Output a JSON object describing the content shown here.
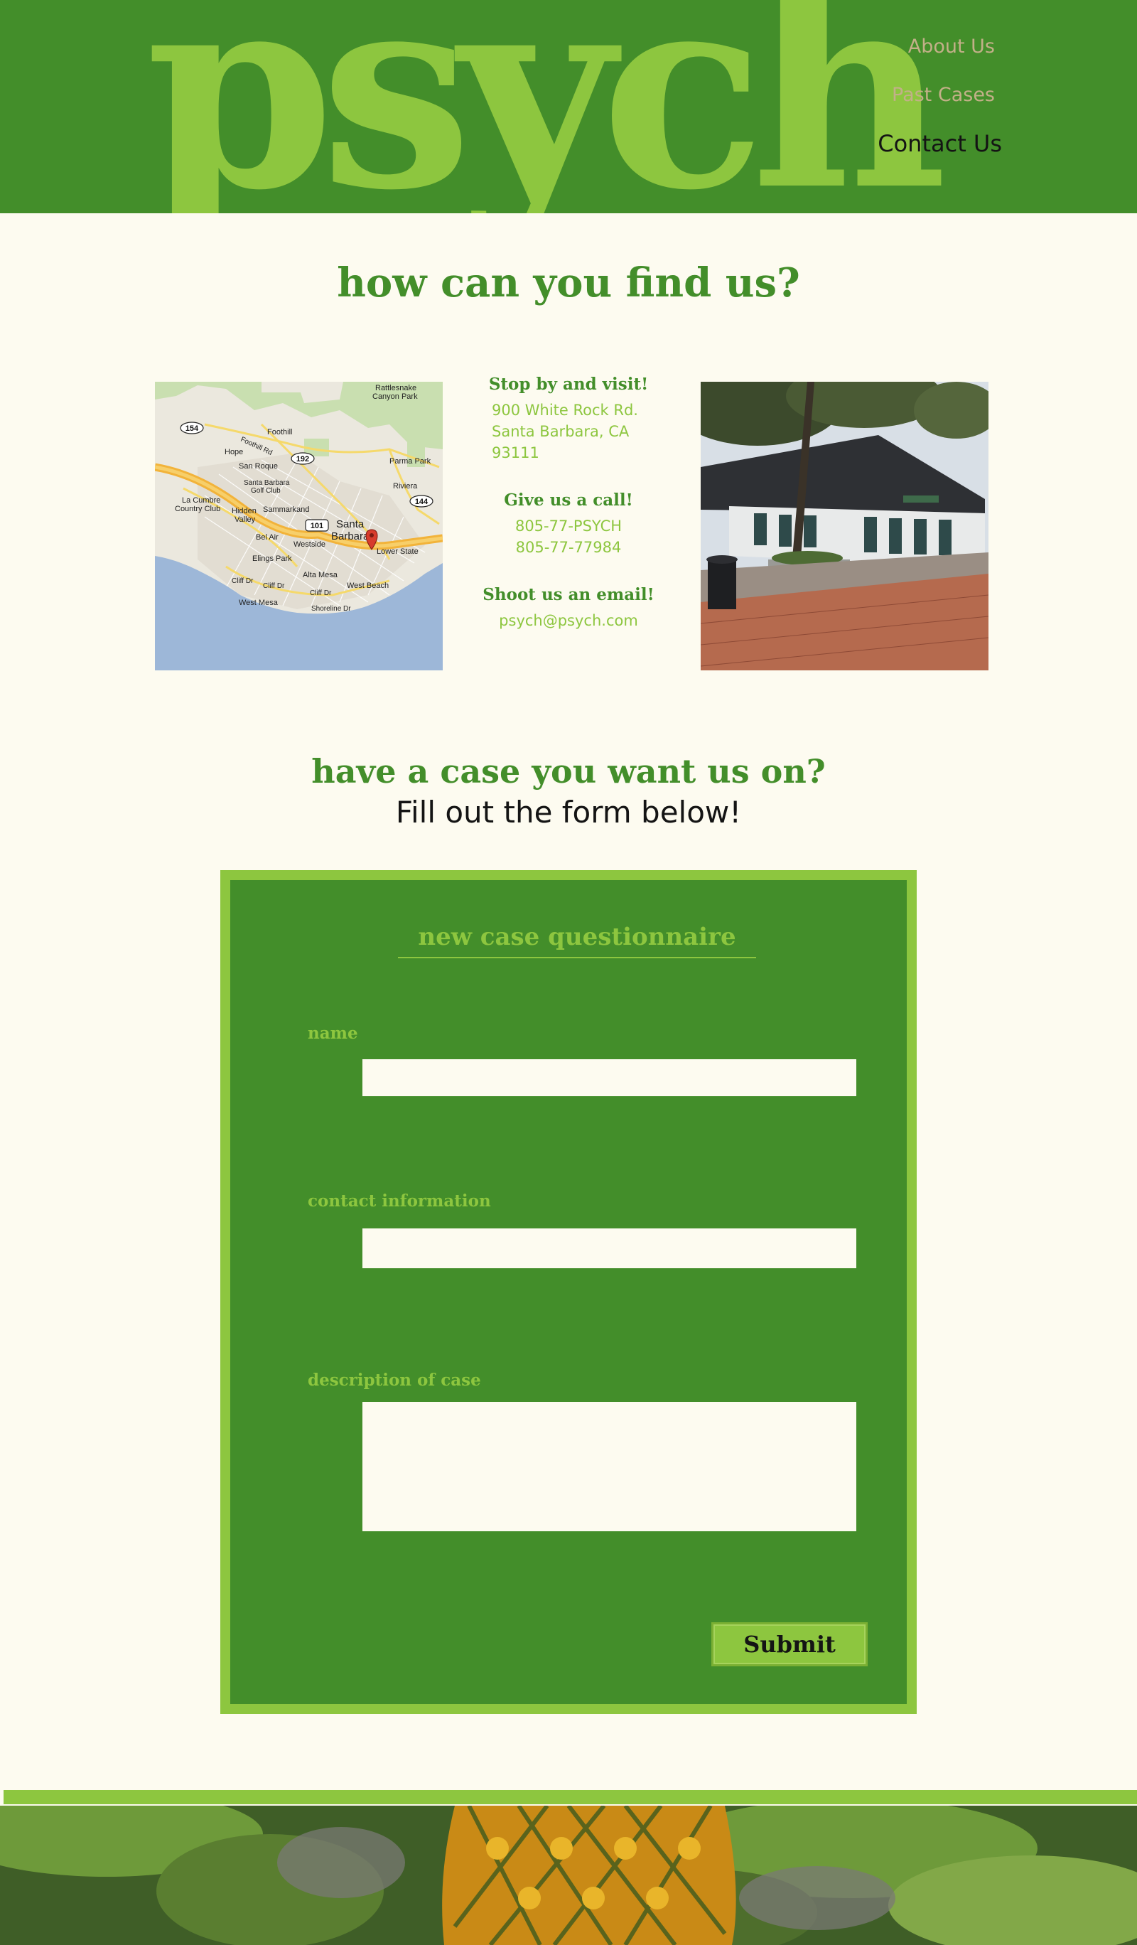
{
  "brand": {
    "logo_text": "psych"
  },
  "nav": {
    "items": [
      {
        "label": "About Us"
      },
      {
        "label": "Past Cases"
      },
      {
        "label": "Contact Us"
      }
    ]
  },
  "find_section": {
    "title": "how can you find us?",
    "visit_heading": "Stop by and visit!",
    "address_line1": "900 White Rock Rd.",
    "address_line2": "Santa Barbara, CA 93111",
    "call_heading": "Give us a call!",
    "phone1": "805-77-PSYCH",
    "phone2": "805-77-77984",
    "email_heading": "Shoot us an email!",
    "email": "psych@psych.com"
  },
  "map": {
    "labels": {
      "rattlesnake": "Rattlesnake",
      "canyon_park": "Canyon Park",
      "foothill": "Foothill",
      "foothill_rd": "Foothill Rd",
      "hope": "Hope",
      "san_roque": "San Roque",
      "parma_park": "Parma Park",
      "santa_barbara_golf": "Santa Barbara",
      "golf_club": "Golf Club",
      "riviera": "Riviera",
      "la_cumbre": "La Cumbre",
      "country_club": "Country Club",
      "hidden": "Hidden",
      "valley": "Valley",
      "sammarkand": "Sammarkand",
      "bel_air": "Bel Air",
      "westside": "Westside",
      "santa": "Santa",
      "barbara": "Barbara",
      "lower_state": "Lower State",
      "ellings_park": "Elings Park",
      "alta_mesa": "Alta Mesa",
      "west_beach": "West Beach",
      "cliff_dr1": "Cliff Dr",
      "cliff_dr2": "Cliff Dr",
      "cliff_dr3": "Cliff Dr",
      "west_mesa": "West Mesa",
      "shoreline_dr": "Shoreline Dr",
      "hw154": "154",
      "hw192": "192",
      "hw101": "101",
      "hw144": "144"
    }
  },
  "case_section": {
    "title": "have a case you want us on?",
    "subtitle": "Fill out the form below!"
  },
  "form": {
    "title": "new case questionnaire",
    "name_label": "name",
    "contact_label": "contact information",
    "description_label": "description of case",
    "submit_label": "Submit"
  },
  "colors": {
    "header_green": "#438e2a",
    "accent_lime": "#8dc63f",
    "background_cream": "#fdfbf0",
    "nav_tan": "#c2b088"
  }
}
